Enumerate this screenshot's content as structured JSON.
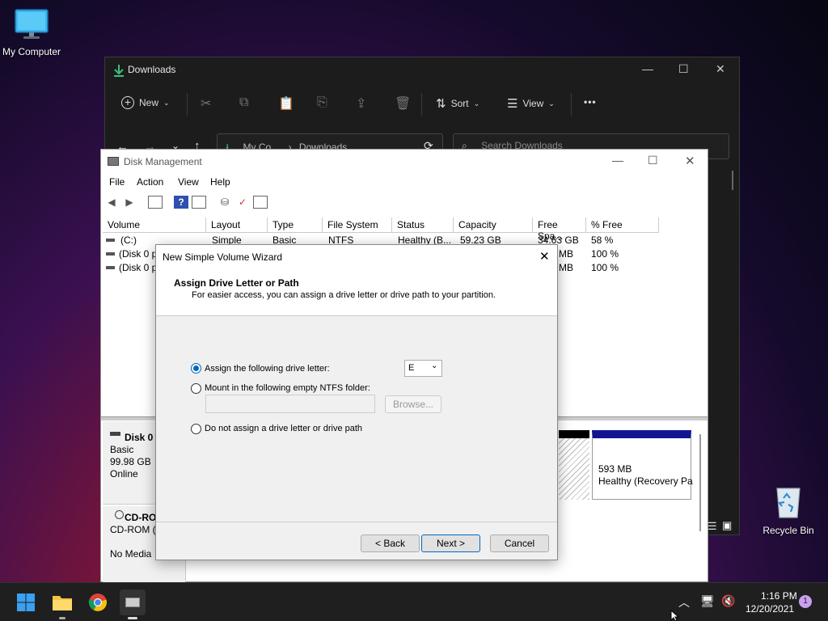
{
  "desktop": {
    "my_computer": "My Computer",
    "recycle_bin": "Recycle Bin"
  },
  "explorer": {
    "title": "Downloads",
    "toolbar": {
      "new": "New",
      "sort": "Sort",
      "view": "View",
      "more": "•••"
    },
    "address": {
      "path_part1": "My Co...",
      "path_part2": "Downloads",
      "sep": "›"
    },
    "search_placeholder": "Search Downloads"
  },
  "disk_mgmt": {
    "title": "Disk Management",
    "menu": [
      "File",
      "Action",
      "View",
      "Help"
    ],
    "columns": [
      "Volume",
      "Layout",
      "Type",
      "File System",
      "Status",
      "Capacity",
      "Free Spa...",
      "% Free"
    ],
    "rows": [
      {
        "volume": "(C:)",
        "layout": "Simple",
        "type": "Basic",
        "fs": "NTFS",
        "status": "Healthy (B...",
        "capacity": "59.23 GB",
        "free": "34.63 GB",
        "pct": "58 %"
      },
      {
        "volume": "(Disk 0 pa",
        "layout": "",
        "type": "",
        "fs": "",
        "status": "",
        "capacity": "",
        "free": "MB",
        "pct": "100 %"
      },
      {
        "volume": "(Disk 0 pa",
        "layout": "",
        "type": "",
        "fs": "",
        "status": "",
        "capacity": "",
        "free": "MB",
        "pct": "100 %"
      }
    ],
    "disk0": {
      "name": "Disk 0",
      "type": "Basic",
      "size": "99.98 GB",
      "state": "Online"
    },
    "cdrom": {
      "name": "CD-ROM",
      "type": "CD-ROM (I",
      "media": "No Media"
    },
    "partition": {
      "size": "593 MB",
      "status": "Healthy (Recovery Pa"
    }
  },
  "wizard": {
    "title": "New Simple Volume Wizard",
    "heading": "Assign Drive Letter or Path",
    "subheading": "For easier access, you can assign a drive letter or drive path to your partition.",
    "opt_assign": "Assign the following drive letter:",
    "drive_letter": "E",
    "opt_mount": "Mount in the following empty NTFS folder:",
    "browse": "Browse...",
    "opt_none": "Do not assign a drive letter or drive path",
    "back": "< Back",
    "next": "Next >",
    "cancel": "Cancel"
  },
  "taskbar": {
    "time": "1:16 PM",
    "date": "12/20/2021",
    "notification_count": "1"
  },
  "colors": {
    "accent": "#0067c0",
    "taskbar": "#1f1f1f",
    "explorer_bg": "#1c1c1c"
  }
}
